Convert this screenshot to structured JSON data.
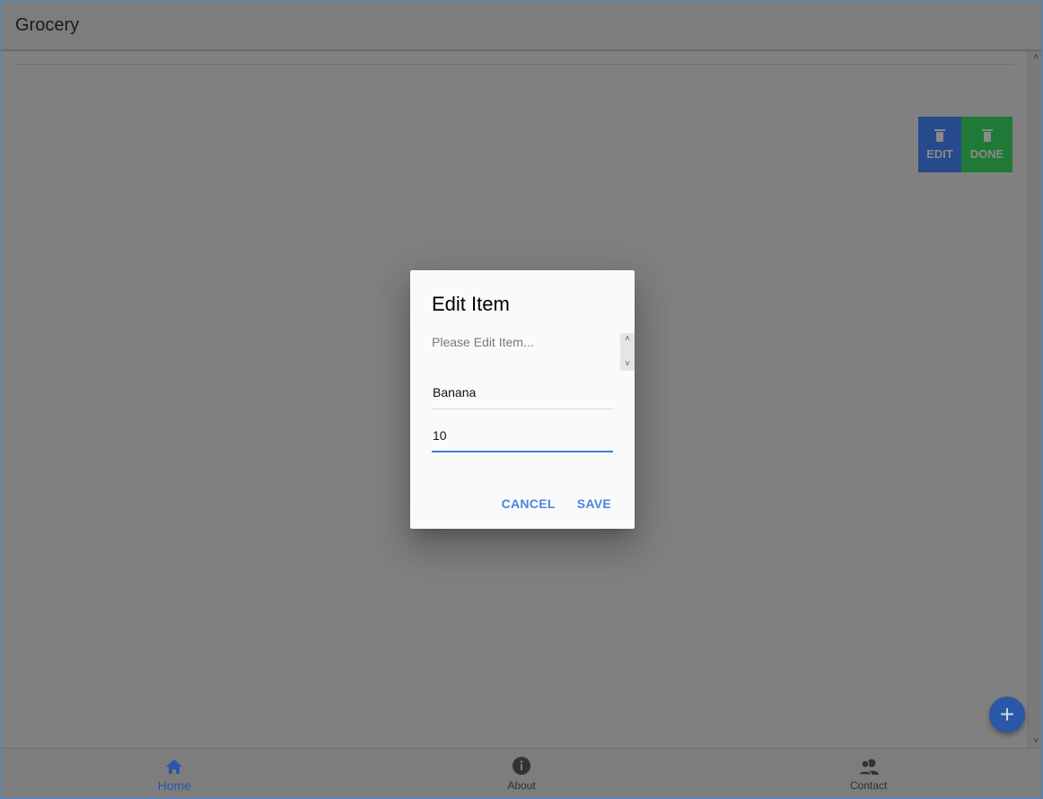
{
  "header": {
    "title": "Grocery"
  },
  "swipe_actions": {
    "edit_label": "EDIT",
    "done_label": "DONE"
  },
  "dialog": {
    "title": "Edit Item",
    "message": "Please Edit Item...",
    "name_value": "Banana",
    "quantity_value": "10",
    "cancel_label": "CANCEL",
    "save_label": "SAVE"
  },
  "fab": {
    "icon": "plus-icon"
  },
  "tabs": [
    {
      "label": "Home",
      "icon": "home-icon",
      "active": true
    },
    {
      "label": "About",
      "icon": "info-icon",
      "active": false
    },
    {
      "label": "Contact",
      "icon": "contacts-icon",
      "active": false
    }
  ],
  "colors": {
    "primary": "#2a57a8",
    "edit": "#264a8c",
    "done": "#1e7a36",
    "dialog_accent": "#4a86dc"
  }
}
